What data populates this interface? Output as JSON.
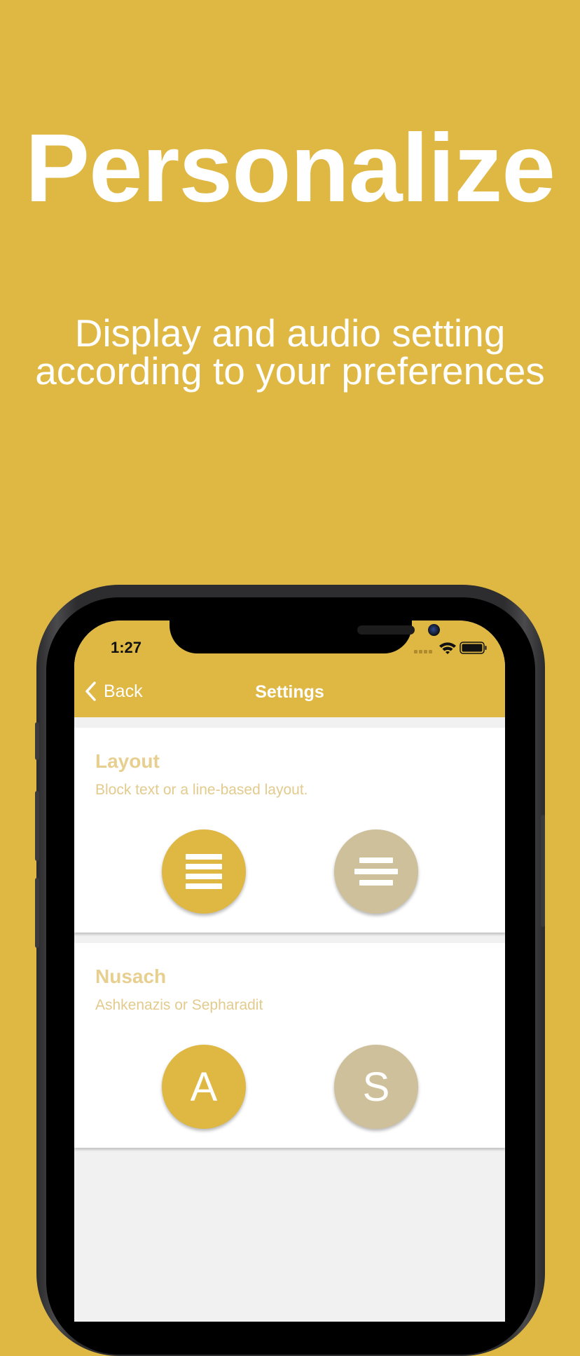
{
  "promo": {
    "headline": "Personalize",
    "subhead_line1": "Display and audio setting",
    "subhead_line2": "according to your preferences"
  },
  "status_bar": {
    "time": "1:27",
    "icons": [
      "cellular-signal-icon",
      "wifi-icon",
      "battery-icon"
    ]
  },
  "nav": {
    "back_label": "Back",
    "title": "Settings"
  },
  "sections": [
    {
      "title": "Layout",
      "description": "Block text or a line-based layout.",
      "options": [
        {
          "icon": "block-layout-icon",
          "selected": true
        },
        {
          "icon": "line-layout-icon",
          "selected": false
        }
      ]
    },
    {
      "title": "Nusach",
      "description": "Ashkenazis or Sepharadit",
      "options": [
        {
          "label": "A",
          "selected": true
        },
        {
          "label": "S",
          "selected": false
        }
      ]
    }
  ],
  "colors": {
    "brand_gold": "#dfb743",
    "inactive_beige": "#cdc09a",
    "muted_gold_text": "#e7cf90",
    "screen_bg": "#f1f1f1"
  }
}
